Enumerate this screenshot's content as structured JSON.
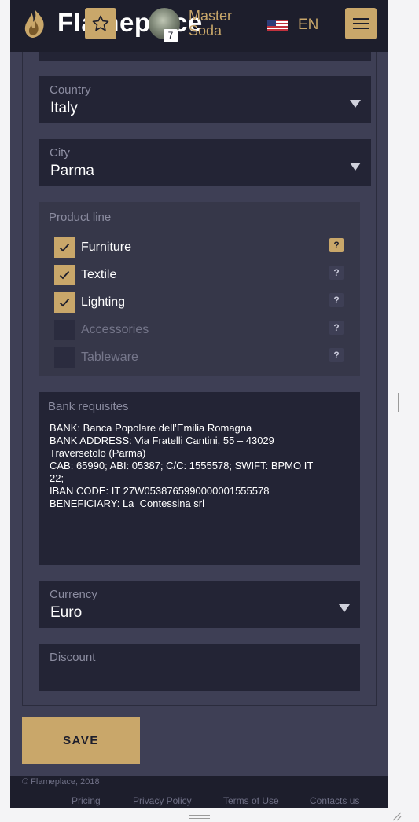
{
  "header": {
    "logo_text": "Flameplace",
    "user_name": "Master Soda",
    "avatar_badge": "7",
    "language": "EN"
  },
  "form": {
    "country": {
      "label": "Country",
      "value": "Italy"
    },
    "city": {
      "label": "City",
      "value": "Parma"
    },
    "product_line": {
      "label": "Product line",
      "items": [
        {
          "label": "Furniture",
          "checked": true,
          "help": "?"
        },
        {
          "label": "Textile",
          "checked": true,
          "help": "?"
        },
        {
          "label": "Lighting",
          "checked": true,
          "help": "?"
        },
        {
          "label": "Accessories",
          "checked": false,
          "help": "?"
        },
        {
          "label": "Tableware",
          "checked": false,
          "help": "?"
        }
      ]
    },
    "bank": {
      "label": "Bank requisites",
      "value": "BANK: Banca Popolare dell’Emilia Romagna\nBANK ADDRESS: Via Fratelli Cantini, 55 – 43029\nTraversetolo (Parma)\nCAB: 65990; ABI: 05387; C/C: 1555578; SWIFT: BPMO IT\n22;\nIBAN CODE: IT 27W0538765990000001555578\nBENEFICIARY: La  Contessina srl"
    },
    "currency": {
      "label": "Currency",
      "value": "Euro"
    },
    "discount": {
      "label": "Discount",
      "value": ""
    },
    "save_label": "SAVE"
  },
  "footer": {
    "copyright": "© Flameplace, 2018",
    "links": [
      "Pricing",
      "Privacy Policy",
      "Terms of Use",
      "Contacts us"
    ]
  },
  "colors": {
    "accent": "#c9a76a",
    "topbar": "#1d1e2c",
    "page_bg": "#3e3f55",
    "field_bg": "#232435"
  }
}
